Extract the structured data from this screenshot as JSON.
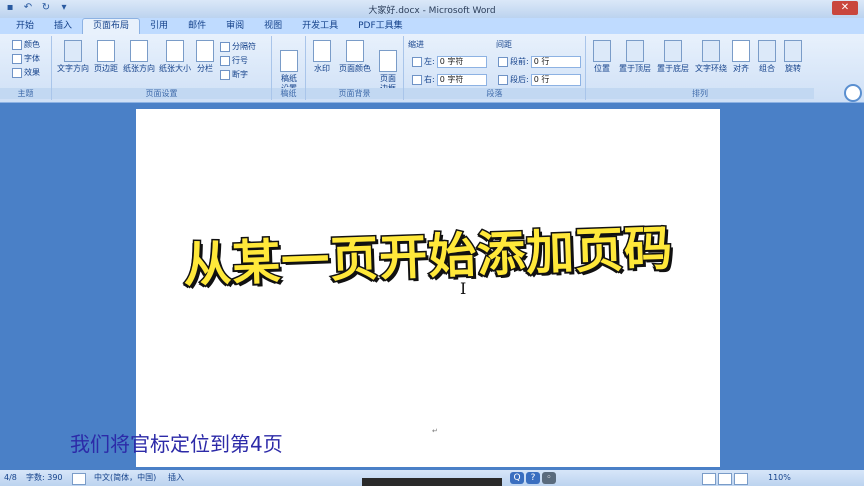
{
  "window": {
    "title": "大家好.docx - Microsoft Word",
    "close_glyph": "✕"
  },
  "tabs": [
    {
      "label": "开始"
    },
    {
      "label": "插入"
    },
    {
      "label": "页面布局",
      "active": true
    },
    {
      "label": "引用"
    },
    {
      "label": "邮件"
    },
    {
      "label": "审阅"
    },
    {
      "label": "视图"
    },
    {
      "label": "开发工具"
    },
    {
      "label": "PDF工具集"
    }
  ],
  "ribbon": {
    "theme": {
      "colors": "颜色",
      "fonts": "字体",
      "effects": "效果",
      "label": "主题"
    },
    "page_setup": {
      "text_direction": "文字方向",
      "margins": "页边距",
      "orientation": "纸张方向",
      "size": "纸张大小",
      "columns": "分栏",
      "breaks": "分隔符",
      "line_numbers": "行号",
      "hyphenation": "断字",
      "label": "页面设置"
    },
    "draft": {
      "button": "稿纸\n设置",
      "label": "稿纸"
    },
    "page_background": {
      "watermark": "水印",
      "page_color": "页面颜色",
      "page_borders": "页面\n边框",
      "label": "页面背景"
    },
    "paragraph": {
      "indent": "缩进",
      "left": "左:",
      "right": "右:",
      "left_value": "0 字符",
      "right_value": "0 字符",
      "spacing": "间距",
      "before": "段前:",
      "after": "段后:",
      "before_value": "0 行",
      "after_value": "0 行",
      "label": "段落"
    },
    "arrange": {
      "position": "位置",
      "bring_front": "置于顶层",
      "send_back": "置于底层",
      "text_wrap": "文字环绕",
      "align": "对齐",
      "group": "组合",
      "rotate": "旋转",
      "label": "排列"
    }
  },
  "document": {
    "headline": "从某一页开始添加页码",
    "cursor_glyph": "I",
    "para_mark": "↵"
  },
  "caption": "我们将官标定位到第4页",
  "status": {
    "page": "4/8",
    "words": "字数: 390",
    "language": "中文(简体，中国)",
    "mode": "插入",
    "zoom": "110%"
  },
  "colors": {
    "accent": "#15428b",
    "headline_fill": "#ffe83a",
    "caption": "#2c2aa8",
    "background": "#4a80c7"
  }
}
